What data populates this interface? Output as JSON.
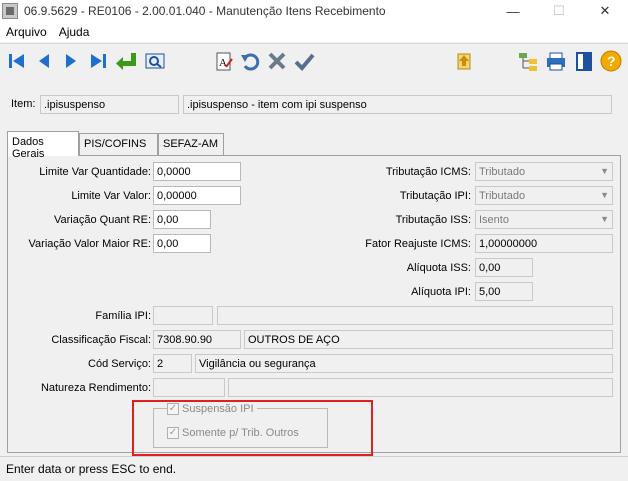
{
  "window": {
    "title": "06.9.5629 - RE0106 - 2.00.01.040 - Manutenção Itens Recebimento",
    "controls": [
      "minimize",
      "maximize",
      "close"
    ]
  },
  "menu": {
    "items": [
      "Arquivo",
      "Ajuda"
    ]
  },
  "toolbar": {
    "left": [
      "first-icon",
      "previous-icon",
      "next-icon",
      "last-icon",
      "goto-icon",
      "search-icon"
    ],
    "middle": [
      "edit-text-icon",
      "undo-icon",
      "delete-icon",
      "confirm-icon"
    ],
    "right": [
      "up-arrow-icon",
      "tree-icon",
      "print-icon",
      "exit-icon",
      "help-icon"
    ]
  },
  "item": {
    "label": "Item:",
    "code": ".ipisuspenso",
    "description": ".ipisuspenso - item com ipi suspenso"
  },
  "tabs": [
    "Dados Gerais",
    "PIS/COFINS",
    "SEFAZ-AM"
  ],
  "fields": {
    "limite_var_quantidade": {
      "label": "Limite Var Quantidade:",
      "value": "0,0000"
    },
    "limite_var_valor": {
      "label": "Limite Var Valor:",
      "value": "0,00000"
    },
    "variacao_quant_re": {
      "label": "Variação Quant RE:",
      "value": "0,00"
    },
    "variacao_valor_maior_re": {
      "label": "Variação Valor Maior RE:",
      "value": "0,00"
    },
    "tributacao_icms": {
      "label": "Tributação ICMS:",
      "value": "Tributado"
    },
    "tributacao_ipi": {
      "label": "Tributação IPI:",
      "value": "Tributado"
    },
    "tributacao_iss": {
      "label": "Tributação ISS:",
      "value": "Isento"
    },
    "fator_reajuste_icms": {
      "label": "Fator Reajuste ICMS:",
      "value": "1,00000000"
    },
    "aliquota_iss": {
      "label": "Alíquota ISS:",
      "value": "0,00"
    },
    "aliquota_ipi": {
      "label": "Alíquota IPI:",
      "value": "5,00"
    },
    "familia_ipi": {
      "label": "Família IPI:",
      "code": "",
      "description": ""
    },
    "classificacao_fiscal": {
      "label": "Classificação Fiscal:",
      "code": "7308.90.90",
      "description": "OUTROS DE AÇO"
    },
    "cod_servico": {
      "label": "Cód Serviço:",
      "code": "2",
      "description": "Vigilância ou segurança"
    },
    "natureza_rendimento": {
      "label": "Natureza Rendimento:",
      "code": "",
      "description": ""
    }
  },
  "checks": {
    "suspensao_ipi": {
      "label": "Suspensão IPI",
      "checked": true,
      "enabled": false
    },
    "somente_trib_outros": {
      "label": "Somente p/ Trib. Outros",
      "checked": true,
      "enabled": false
    }
  },
  "status": {
    "text": "Enter data or press ESC to end."
  },
  "colors": {
    "highlight": "#e02020",
    "nav_blue": "#1f6fd1",
    "confirm_green": "#3a9a1a"
  }
}
